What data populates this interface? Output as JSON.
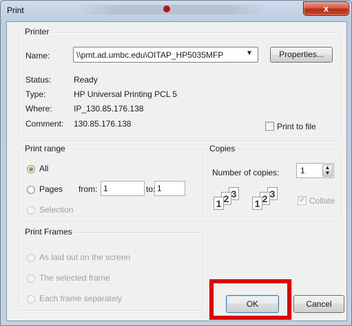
{
  "window": {
    "title": "Print",
    "close_label": "x"
  },
  "printer": {
    "group_label": "Printer",
    "name_label": "Name:",
    "name_value": "\\\\pmt.ad.umbc.edu\\OITAP_HP5035MFP",
    "properties_label": "Properties...",
    "status_label": "Status:",
    "status_value": "Ready",
    "type_label": "Type:",
    "type_value": "HP Universal Printing PCL 5",
    "where_label": "Where:",
    "where_value": "IP_130.85.176.138",
    "comment_label": "Comment:",
    "comment_value": "130.85.176.138",
    "print_to_file_label": "Print to file",
    "print_to_file_checked": false
  },
  "print_range": {
    "group_label": "Print range",
    "all_label": "All",
    "pages_label": "Pages",
    "from_label": "from:",
    "from_value": "1",
    "to_label": "to:",
    "to_value": "1",
    "selection_label": "Selection",
    "selected": "All"
  },
  "copies": {
    "group_label": "Copies",
    "number_label": "Number of copies:",
    "number_value": "1",
    "collate_label": "Collate",
    "collate_checked": true
  },
  "print_frames": {
    "group_label": "Print Frames",
    "options": [
      "As laid out on the screen",
      "The selected frame",
      "Each frame separately"
    ]
  },
  "buttons": {
    "ok_label": "OK",
    "cancel_label": "Cancel"
  },
  "colors": {
    "highlight": "#e00000",
    "close_button": "#c9482f"
  }
}
